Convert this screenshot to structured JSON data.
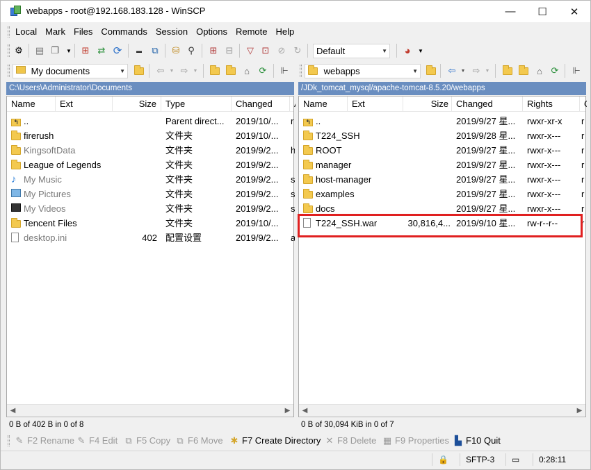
{
  "window": {
    "title": "webapps - root@192.168.183.128 - WinSCP",
    "minimize": "—",
    "maximize": "☐",
    "close": "✕"
  },
  "menu": [
    "Local",
    "Mark",
    "Files",
    "Commands",
    "Session",
    "Options",
    "Remote",
    "Help"
  ],
  "toolbar": {
    "transfer_profile": "Default"
  },
  "left": {
    "location": "My documents",
    "path": "C:\\Users\\Administrator\\Documents",
    "columns": [
      "Name",
      "Ext",
      "Size",
      "Type",
      "Changed",
      "A"
    ],
    "rows": [
      {
        "name": "..",
        "size": "",
        "type": "Parent direct...",
        "changed": "2019/10/...",
        "attr": "r",
        "icon": "parent-dir-icon",
        "gray": false
      },
      {
        "name": "firerush",
        "size": "",
        "type": "文件夹",
        "changed": "2019/10/...",
        "attr": "",
        "icon": "folder-icon",
        "gray": false
      },
      {
        "name": "KingsoftData",
        "size": "",
        "type": "文件夹",
        "changed": "2019/9/2...",
        "attr": "h",
        "icon": "folder-icon",
        "gray": true
      },
      {
        "name": "League of Legends",
        "size": "",
        "type": "文件夹",
        "changed": "2019/9/2...",
        "attr": "",
        "icon": "folder-icon",
        "gray": false
      },
      {
        "name": "My Music",
        "size": "",
        "type": "文件夹",
        "changed": "2019/9/2...",
        "attr": "s",
        "icon": "music-icon",
        "gray": true
      },
      {
        "name": "My Pictures",
        "size": "",
        "type": "文件夹",
        "changed": "2019/9/2...",
        "attr": "s",
        "icon": "pictures-icon",
        "gray": true
      },
      {
        "name": "My Videos",
        "size": "",
        "type": "文件夹",
        "changed": "2019/9/2...",
        "attr": "s",
        "icon": "videos-icon",
        "gray": true
      },
      {
        "name": "Tencent Files",
        "size": "",
        "type": "文件夹",
        "changed": "2019/10/...",
        "attr": "",
        "icon": "folder-icon",
        "gray": false
      },
      {
        "name": "desktop.ini",
        "size": "402",
        "type": "配置设置",
        "changed": "2019/9/2...",
        "attr": "a",
        "icon": "file-icon",
        "gray": true
      }
    ],
    "status": "0 B of 402 B in 0 of 8"
  },
  "right": {
    "location": "webapps",
    "path": "/JDk_tomcat_mysql/apache-tomcat-8.5.20/webapps",
    "columns": [
      "Name",
      "Ext",
      "Size",
      "Changed",
      "Rights",
      "O"
    ],
    "rows": [
      {
        "name": "..",
        "size": "",
        "changed": "2019/9/27 星...",
        "rights": "rwxr-xr-x",
        "owner": "r",
        "icon": "parent-dir-icon"
      },
      {
        "name": "T224_SSH",
        "size": "",
        "changed": "2019/9/28 星...",
        "rights": "rwxr-x---",
        "owner": "r",
        "icon": "folder-icon"
      },
      {
        "name": "ROOT",
        "size": "",
        "changed": "2019/9/27 星...",
        "rights": "rwxr-x---",
        "owner": "r",
        "icon": "folder-icon"
      },
      {
        "name": "manager",
        "size": "",
        "changed": "2019/9/27 星...",
        "rights": "rwxr-x---",
        "owner": "r",
        "icon": "folder-icon"
      },
      {
        "name": "host-manager",
        "size": "",
        "changed": "2019/9/27 星...",
        "rights": "rwxr-x---",
        "owner": "r",
        "icon": "folder-icon"
      },
      {
        "name": "examples",
        "size": "",
        "changed": "2019/9/27 星...",
        "rights": "rwxr-x---",
        "owner": "r",
        "icon": "folder-icon"
      },
      {
        "name": "docs",
        "size": "",
        "changed": "2019/9/27 星...",
        "rights": "rwxr-x---",
        "owner": "r",
        "icon": "folder-icon"
      },
      {
        "name": "T224_SSH.war",
        "size": "30,816,4...",
        "changed": "2019/9/10 星...",
        "rights": "rw-r--r--",
        "owner": "r",
        "icon": "file-icon"
      }
    ],
    "status": "0 B of 30,094 KiB in 0 of 7"
  },
  "commands": [
    {
      "key": "F2",
      "label": "F2 Rename",
      "enabled": false
    },
    {
      "key": "F4",
      "label": "F4 Edit",
      "enabled": false
    },
    {
      "key": "F5",
      "label": "F5 Copy",
      "enabled": false
    },
    {
      "key": "F6",
      "label": "F6 Move",
      "enabled": false
    },
    {
      "key": "F7",
      "label": "F7 Create Directory",
      "enabled": true
    },
    {
      "key": "F8",
      "label": "F8 Delete",
      "enabled": false
    },
    {
      "key": "F9",
      "label": "F9 Properties",
      "enabled": false
    },
    {
      "key": "F10",
      "label": "F10 Quit",
      "enabled": true
    }
  ],
  "statusbar": {
    "protocol": "SFTP-3",
    "elapsed": "0:28:11"
  },
  "colors": {
    "path_bar": "#6a8ec0",
    "highlight": "#e02020",
    "folder": "#f3c94f"
  }
}
